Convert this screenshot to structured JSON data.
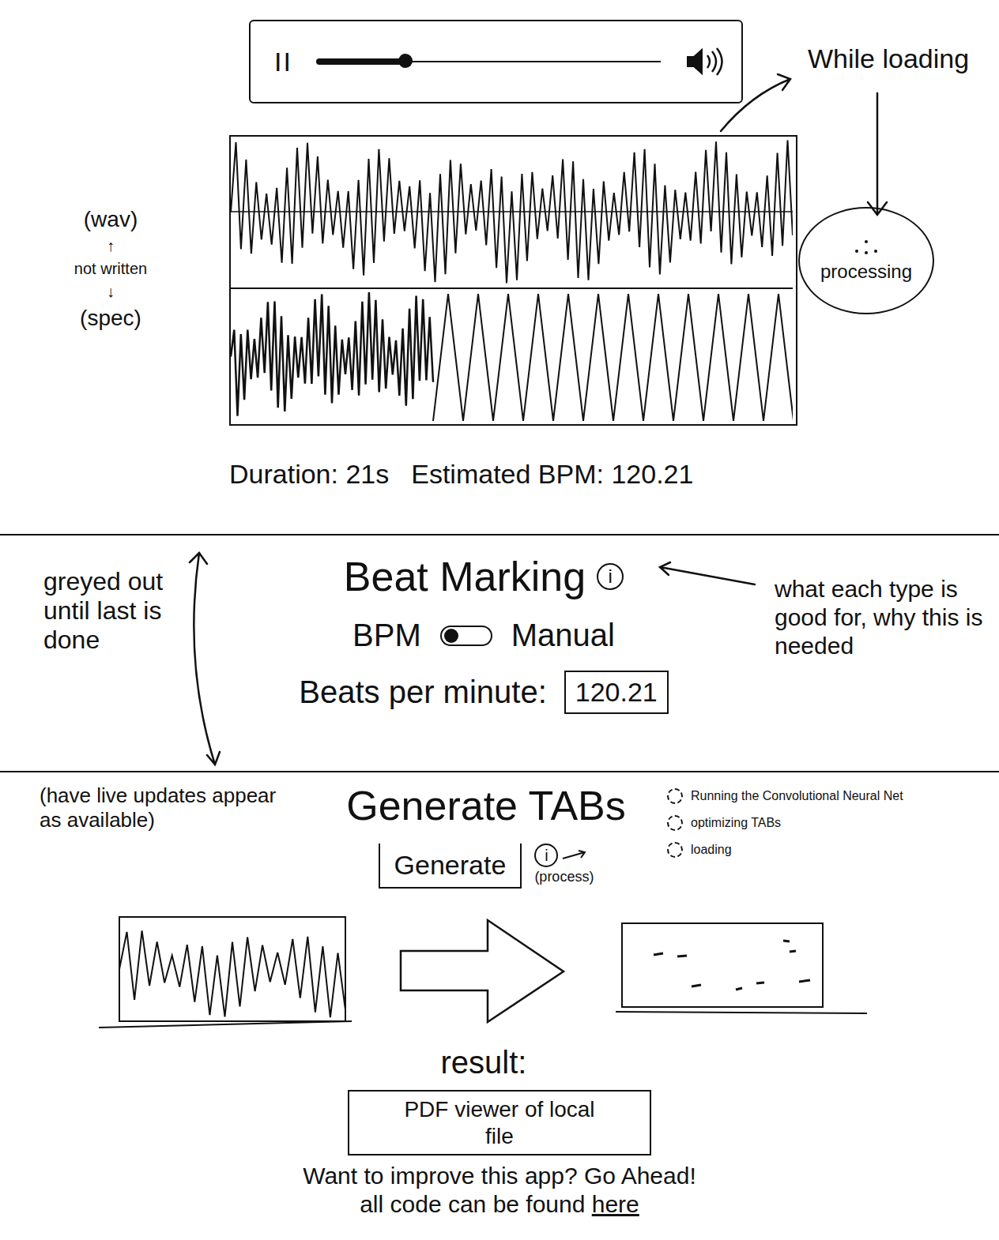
{
  "player": {
    "pause": "II",
    "level": 0.26
  },
  "loading_note": "While loading",
  "processing": {
    "label": "processing"
  },
  "track_labels": {
    "wav": "(wav)",
    "up": "↑",
    "note": "not written",
    "down": "↓",
    "spec": "(spec)"
  },
  "spectrogram": {
    "level": 0.36
  },
  "stats": {
    "duration": "Duration: 21s",
    "bpm": "Estimated BPM: 120.21"
  },
  "beat_marking": {
    "title": "Beat Marking",
    "info": "i",
    "modes": [
      {
        "label": "BPM",
        "selected": true
      },
      {
        "label": "Manual",
        "selected": false
      }
    ],
    "bpm_label": "Beats per minute:",
    "bpm_value": "120.21",
    "info_note": "what each type is good for, why this is needed",
    "greyed_note": "greyed out until last is done"
  },
  "generate": {
    "title": "Generate TABs",
    "info": "i",
    "info_label": "(process)",
    "button": "Generate",
    "live_note": "(have live updates appear as available)",
    "steps": [
      {
        "label": "Running the Convolutional Neural Net",
        "done": false
      },
      {
        "label": "optimizing TABs",
        "done": false
      },
      {
        "label": "loading",
        "done": false
      }
    ]
  },
  "result": {
    "label": "result:",
    "viewer": "PDF viewer of local file"
  },
  "footer": {
    "line1": "Want to improve this app? Go Ahead!",
    "line2": "all code can be found",
    "link": "here"
  }
}
